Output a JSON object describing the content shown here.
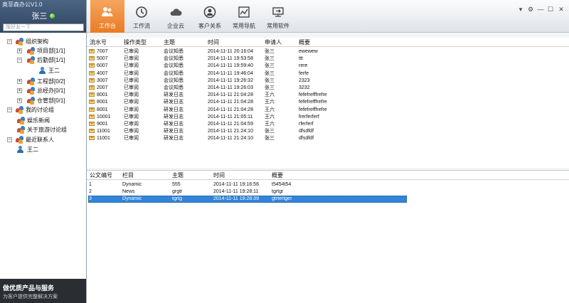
{
  "app": {
    "title": "奥菲森办公V1.0"
  },
  "user": {
    "name": "张三",
    "status_color": "#3ea81a"
  },
  "search": {
    "placeholder": "搜好友一下"
  },
  "tree": [
    {
      "label": "组织架构",
      "kind": "group",
      "toggle": "⊟"
    },
    {
      "label": "项目部[1/1]",
      "kind": "group",
      "toggle": "⊞"
    },
    {
      "label": "后勤部[1/1]",
      "kind": "group",
      "toggle": "⊟"
    },
    {
      "label": "王二",
      "kind": "user",
      "toggle": ""
    },
    {
      "label": "工程部[0/2]",
      "kind": "group",
      "toggle": "⊞"
    },
    {
      "label": "总经办[0/1]",
      "kind": "group",
      "toggle": "⊞"
    },
    {
      "label": "仓管部[0/1]",
      "kind": "group",
      "toggle": "⊞"
    },
    {
      "label": "我的讨论组",
      "kind": "group",
      "toggle": "⊟"
    },
    {
      "label": "娱乐新闻",
      "kind": "group",
      "toggle": ""
    },
    {
      "label": "关于旅游讨论组",
      "kind": "group",
      "toggle": ""
    },
    {
      "label": "最近联系人",
      "kind": "group",
      "toggle": "⊟"
    },
    {
      "label": "王二",
      "kind": "user",
      "toggle": ""
    }
  ],
  "promo": {
    "title": "做优质产品与服务",
    "subtitle": "为客户提供完整解决方案"
  },
  "tabs": [
    {
      "label": "工作台",
      "icon": "people-icon",
      "active": true
    },
    {
      "label": "工作流",
      "icon": "clock-icon",
      "active": false
    },
    {
      "label": "企业云",
      "icon": "cloud-icon",
      "active": false
    },
    {
      "label": "客户关系",
      "icon": "customer-icon",
      "active": false
    },
    {
      "label": "常用导航",
      "icon": "chart-icon",
      "active": false
    },
    {
      "label": "常用软件",
      "icon": "software-icon",
      "active": false
    }
  ],
  "window_controls": [
    {
      "name": "menu-icon",
      "glyph": "▾"
    },
    {
      "name": "gear-icon",
      "glyph": "⚙"
    },
    {
      "name": "minimize-icon",
      "glyph": "—"
    },
    {
      "name": "maximize-icon",
      "glyph": "☐"
    },
    {
      "name": "close-icon",
      "glyph": "✕"
    }
  ],
  "grid1": {
    "headers": [
      "流水号",
      "操作类型",
      "主题",
      "时间",
      "申请人",
      "概要"
    ],
    "rows": [
      [
        "7007",
        "已审阅",
        "会议知悉",
        "2014-11-11 20:16:04",
        "张三",
        "ewewew"
      ],
      [
        "5007",
        "已审阅",
        "会议知悉",
        "2014-11-11 19:53:58",
        "张三",
        "ttt"
      ],
      [
        "6007",
        "已审阅",
        "会议知悉",
        "2014-11-11 19:59:40",
        "张三",
        "rere"
      ],
      [
        "4007",
        "已审阅",
        "会议知悉",
        "2014-11-11 19:46:04",
        "张三",
        "ferfe"
      ],
      [
        "3007",
        "已审阅",
        "会议知悉",
        "2014-11-11 19:26:32",
        "张三",
        "2323"
      ],
      [
        "2007",
        "已审阅",
        "会议知悉",
        "2014-11-11 19:26:03",
        "张三",
        "3232"
      ],
      [
        "8001",
        "已审阅",
        "研发日志",
        "2014-11-11 21:04:28",
        "王六",
        "fefefrefffrefre"
      ],
      [
        "8001",
        "已审阅",
        "研发日志",
        "2014-11-11 21:04:28",
        "王六",
        "fefefrefffrefre"
      ],
      [
        "8001",
        "已审阅",
        "研发日志",
        "2014-11-11 21:04:28",
        "王六",
        "fefefrefffrefre"
      ],
      [
        "10001",
        "已审阅",
        "研发日志",
        "2014-11-11 21:05:11",
        "王六",
        "frerferferf"
      ],
      [
        "9001",
        "已审阅",
        "研发日志",
        "2014-11-11 21:04:59",
        "王六",
        "rferferf"
      ],
      [
        "11001",
        "已审阅",
        "研发日志",
        "2014-11-11 21:24:10",
        "张三",
        "dfsdfdf"
      ],
      [
        "11001",
        "已审阅",
        "研发日志",
        "2014-11-11 21:24:10",
        "张三",
        "dfsdfdf"
      ]
    ]
  },
  "grid2": {
    "headers": [
      "公文编号",
      "栏目",
      "主题",
      "时间",
      "概要"
    ],
    "rows": [
      [
        "1",
        "Dynamic",
        "555",
        "2014-11-11 19:16:56",
        "t5454t54"
      ],
      [
        "2",
        "News",
        "grgtr",
        "2014-11-11 19:28:11",
        "tgrtgr"
      ],
      [
        "3",
        "Dynamic",
        "tgrtg",
        "2014-11-11 19:28:39",
        "gtrtertger"
      ]
    ],
    "selected_row": 3
  },
  "colors": {
    "accent": "#ea7b22",
    "selection": "#2f7fd4",
    "header_dark": "#2e4460"
  }
}
